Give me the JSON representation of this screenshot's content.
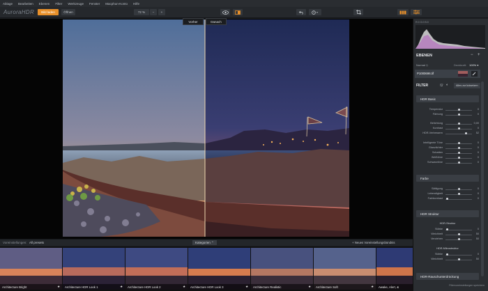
{
  "menu": [
    "Ablage",
    "Bearbeiten",
    "Ebenen",
    "Filter",
    "Werkzeuge",
    "Fenster",
    "Macphun-Konto",
    "Hilfe"
  ],
  "toolbar": {
    "app_logo": "AuroraHDR",
    "add_image": "Bild laden",
    "open": "Öffnen",
    "zoom": "72 %",
    "zoom_minus": "−",
    "zoom_plus": "+"
  },
  "viewer": {
    "before_label": "Vorher",
    "after_label": "Danach"
  },
  "presets": {
    "left_label": "Voreinstellungen:",
    "left_value": "All presets",
    "category_button": "Kategorien ⌃",
    "new_preset": "+ Neues Voreinstellungsbündnis",
    "items": [
      {
        "name": "Architecture Bright"
      },
      {
        "name": "Architecture HDR Look 1"
      },
      {
        "name": "Architecture HDR Look 2"
      },
      {
        "name": "Architecture HDR Look 3"
      },
      {
        "name": "Architecture Realistic"
      },
      {
        "name": "Architecture Soft"
      },
      {
        "name": "Awake, Alert, &"
      }
    ]
  },
  "histogram_info": "R:0  G:0  B:0",
  "layers": {
    "title": "EBENEN",
    "blend_mode": "Normal ◇",
    "opacity_label": "Deckkraft:",
    "opacity_value": "100% ▾",
    "layer_name": "P1000696.tif"
  },
  "filter": {
    "title": "FILTER",
    "reset_label": "Alles zurücksetzen",
    "hdr_basic": {
      "title": "HDR Basic",
      "rows": [
        {
          "label": "Temperatur",
          "value": "0",
          "pos": 0.5
        },
        {
          "label": "Färbung",
          "value": "0",
          "pos": 0.5
        },
        {
          "label": "Belichtung",
          "value": "0,00",
          "pos": 0.5
        },
        {
          "label": "Kontrast",
          "value": "0",
          "pos": 0.5
        },
        {
          "label": "HDR-Verbessern",
          "value": "52",
          "pos": 0.76
        },
        {
          "label": "Intelligente Töne",
          "value": "0",
          "pos": 0.5
        },
        {
          "label": "Glanzlichter",
          "value": "0",
          "pos": 0.5
        },
        {
          "label": "Schatten",
          "value": "0",
          "pos": 0.5
        },
        {
          "label": "Weißtöne",
          "value": "0",
          "pos": 0.5
        },
        {
          "label": "Schwarztöne",
          "value": "0",
          "pos": 0.5
        }
      ]
    },
    "color": {
      "title": "Farbe",
      "rows": [
        {
          "label": "Sättigung",
          "value": "0",
          "pos": 0.5
        },
        {
          "label": "Lebendigkeit",
          "value": "0",
          "pos": 0.5
        },
        {
          "label": "Farbkontrast",
          "value": "0",
          "pos": 0.05
        }
      ]
    },
    "hdr_structure": {
      "title": "HDR Struktur",
      "sub1": "HDR-Struktur",
      "rows1": [
        {
          "label": "Stärke",
          "value": "0",
          "pos": 0.05
        },
        {
          "label": "Weichheit",
          "value": "50",
          "pos": 0.5
        },
        {
          "label": "Verziehen",
          "value": "50",
          "pos": 0.5
        }
      ],
      "sub2": "HDR-Mikrostruktur",
      "rows2": [
        {
          "label": "Stärke",
          "value": "0",
          "pos": 0.05
        },
        {
          "label": "Weichheit",
          "value": "50",
          "pos": 0.5
        }
      ]
    },
    "denoise": {
      "title": "HDR-Rauschunterdrückung"
    },
    "save_label": "Filtervoreinstellungen speichern"
  }
}
